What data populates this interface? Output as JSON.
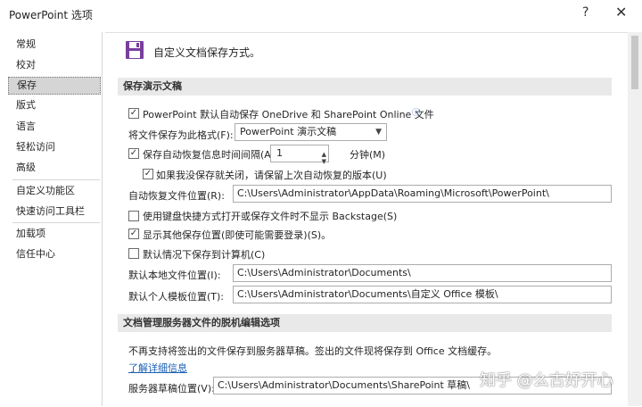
{
  "window": {
    "title": "PowerPoint 选项",
    "help": "?",
    "close": "✕"
  },
  "sidebar": {
    "items": [
      "常规",
      "校对",
      "保存",
      "版式",
      "语言",
      "轻松访问",
      "高级",
      "自定义功能区",
      "快速访问工具栏",
      "加载项",
      "信任中心"
    ]
  },
  "header": {
    "text": "自定义文档保存方式。"
  },
  "section1": {
    "title": "保存演示文稿",
    "autosave": {
      "checked": true,
      "label": "PowerPoint 默认自动保存 OneDrive 和 SharePoint Online 文件"
    },
    "format": {
      "label": "将文件保存为此格式(F):",
      "value": "PowerPoint 演示文稿"
    },
    "autorecover": {
      "checked": true,
      "label": "保存自动恢复信息时间间隔(A)",
      "value": "1",
      "unit": "分钟(M)"
    },
    "keep_last": {
      "checked": true,
      "label": "如果我没保存就关闭，请保留上次自动恢复的版本(U)"
    },
    "autorecover_path": {
      "label": "自动恢复文件位置(R):",
      "value": "C:\\Users\\Administrator\\AppData\\Roaming\\Microsoft\\PowerPoint\\"
    },
    "no_backstage": {
      "checked": false,
      "label": "使用键盘快捷方式打开或保存文件时不显示 Backstage(S)"
    },
    "show_locations": {
      "checked": true,
      "label": "显示其他保存位置(即使可能需要登录)(S)。"
    },
    "save_to_pc": {
      "checked": false,
      "label": "默认情况下保存到计算机(C)"
    },
    "local_path": {
      "label": "默认本地文件位置(I):",
      "value": "C:\\Users\\Administrator\\Documents\\"
    },
    "template_path": {
      "label": "默认个人模板位置(T):",
      "value": "C:\\Users\\Administrator\\Documents\\自定义 Office 模板\\"
    }
  },
  "section2": {
    "title": "文档管理服务器文件的脱机编辑选项",
    "desc": "不再支持将签出的文件保存到服务器草稿。签出的文件现将保存到 Office 文档缓存。",
    "learn_more": "了解详细信息",
    "drafts": {
      "label": "服务器草稿位置(V):",
      "value": "C:\\Users\\Administrator\\Documents\\SharePoint 草稿\\"
    }
  },
  "watermark": "知乎 @么古好开心",
  "icons": {
    "save": "save-icon",
    "info": "info-icon",
    "dropdown": "chevron-down-icon",
    "check": "check-icon"
  },
  "colors": {
    "accent": "#7a3e9d",
    "link": "#1a5fb4",
    "selected": "#d5d5d5",
    "section": "#e9e9e9"
  }
}
